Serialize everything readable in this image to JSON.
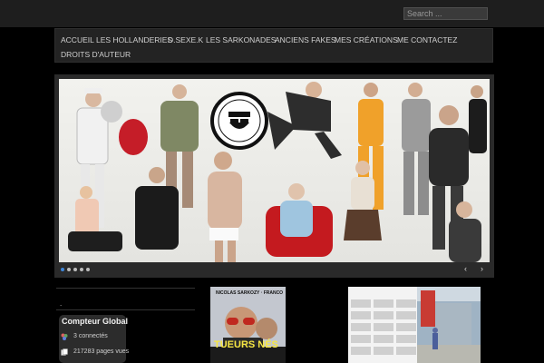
{
  "search": {
    "placeholder": "Search ..."
  },
  "nav": {
    "items": [
      {
        "label": "ACCUEIL"
      },
      {
        "label": "LES HOLLANDERIES"
      },
      {
        "label": "D.SEXE.K"
      },
      {
        "label": "LES SARKONADES"
      },
      {
        "label": "ANCIENS FAKES"
      },
      {
        "label": "MES CRÉATIONS"
      },
      {
        "label": "ME CONTACTEZ"
      },
      {
        "label": "DROITS D'AUTEUR"
      }
    ]
  },
  "slider": {
    "badge_text": "LES FAKES DE SARKO",
    "slide_count": 5,
    "active_slide": 1,
    "prev_label": "‹",
    "next_label": "›",
    "accent_color": "#3f86d8"
  },
  "sidebar": {
    "title": ".",
    "counter": {
      "title": "Compteur Global",
      "connected": "3 connectés",
      "page_views": "217283 pages vues"
    }
  },
  "posts": {
    "thumb1": {
      "line1": "NICOLAS SARKOZY · FRANCOIS BAYROU",
      "title": "TUEURS NÉS"
    }
  }
}
